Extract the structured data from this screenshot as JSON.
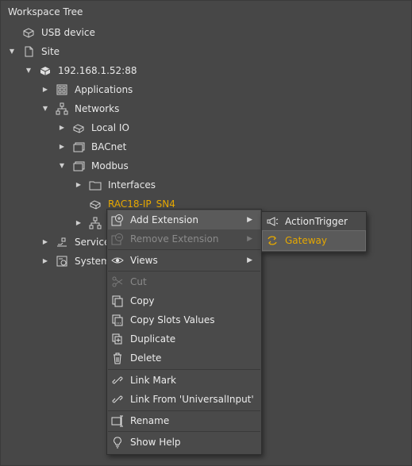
{
  "panel": {
    "title": "Workspace Tree"
  },
  "tree": {
    "usb_device": "USB device",
    "site": "Site",
    "device_ip": "192.168.1.52:88",
    "applications": "Applications",
    "networks": "Networks",
    "local_io": "Local IO",
    "bacnet": "BACnet",
    "modbus": "Modbus",
    "interfaces": "Interfaces",
    "rac18": "RAC18-IP_SN4",
    "services": "Services",
    "system": "System"
  },
  "context_menu": {
    "add_extension": "Add Extension",
    "remove_extension": "Remove Extension",
    "views": "Views",
    "cut": "Cut",
    "copy": "Copy",
    "copy_slots_values": "Copy Slots Values",
    "duplicate": "Duplicate",
    "delete": "Delete",
    "link_mark": "Link Mark",
    "link_from": "Link From 'UniversalInput'",
    "rename": "Rename",
    "show_help": "Show Help"
  },
  "submenu": {
    "action_trigger": "ActionTrigger",
    "gateway": "Gateway"
  },
  "colors": {
    "accent": "#e6a800",
    "background": "#474747",
    "menu_bg": "#4a4a4a"
  }
}
